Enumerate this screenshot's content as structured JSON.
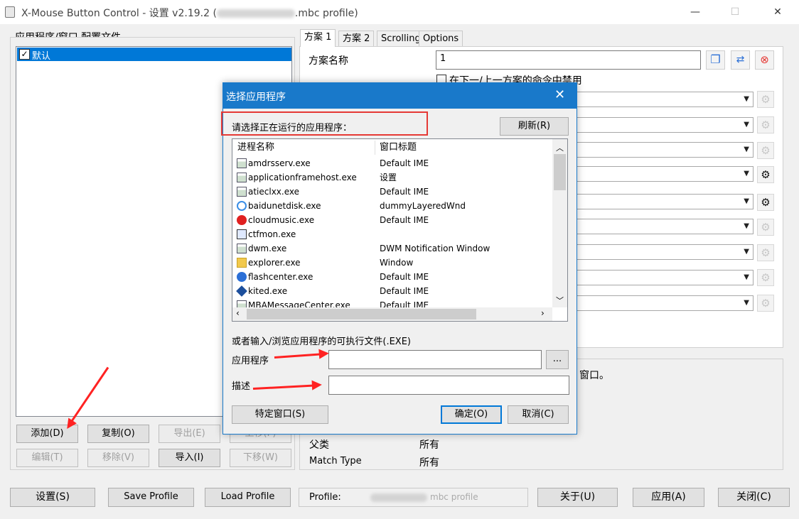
{
  "window": {
    "title_prefix": "X-Mouse Button Control - 设置 v2.19.2 (",
    "title_suffix": ".mbc profile)",
    "minimize": "—",
    "maximize": "☐",
    "close": "✕"
  },
  "left_panel": {
    "group_label": "应用程序/窗口 配置文件",
    "items": [
      {
        "label": "默认",
        "checked": true
      }
    ],
    "buttons": {
      "add": "添加(D)",
      "copy": "复制(O)",
      "export": "导出(E)",
      "move_up": "上移(P)",
      "edit": "编辑(T)",
      "remove": "移除(V)",
      "import": "导入(I)",
      "move_down": "下移(W)"
    }
  },
  "tabs": [
    "方案 1",
    "方案 2",
    "Scrolling",
    "Options"
  ],
  "scheme": {
    "name_label": "方案名称",
    "name_value": "1",
    "disable_label": "在下一/上一方案的命令中禁用"
  },
  "info": {
    "right_text": "窗口。",
    "parent_label": "父类",
    "parent_value": "所有",
    "match_label": "Match Type",
    "match_value": "所有"
  },
  "dialog": {
    "title": "选择应用程序",
    "prompt": "请选择正在运行的应用程序：",
    "refresh": "刷新(R)",
    "col_process": "进程名称",
    "col_window": "窗口标题",
    "processes": [
      {
        "name": "amdrsserv.exe",
        "title": "Default IME",
        "icon": "window-icon"
      },
      {
        "name": "applicationframehost.exe",
        "title": "设置",
        "icon": "window-icon"
      },
      {
        "name": "atieclxx.exe",
        "title": "Default IME",
        "icon": "window-icon"
      },
      {
        "name": "baidunetdisk.exe",
        "title": "dummyLayeredWnd",
        "icon": "cloud-icon"
      },
      {
        "name": "cloudmusic.exe",
        "title": "Default IME",
        "icon": "music-icon"
      },
      {
        "name": "ctfmon.exe",
        "title": "",
        "icon": "pen-icon"
      },
      {
        "name": "dwm.exe",
        "title": "DWM Notification Window",
        "icon": "window-icon"
      },
      {
        "name": "explorer.exe",
        "title": "Window",
        "icon": "folder-icon"
      },
      {
        "name": "flashcenter.exe",
        "title": "Default IME",
        "icon": "flash-icon"
      },
      {
        "name": "kited.exe",
        "title": "Default IME",
        "icon": "kite-icon"
      },
      {
        "name": "MBAMessageCenter.exe",
        "title": "Default IME",
        "icon": "window-icon"
      }
    ],
    "browse_label": "或者输入/浏览应用程序的可执行文件(.EXE)",
    "app_label": "应用程序",
    "app_value": "",
    "browse_button": "...",
    "desc_label": "描述",
    "desc_value": "",
    "specific_window": "特定窗口(S)",
    "ok": "确定(O)",
    "cancel": "取消(C)"
  },
  "bottom": {
    "settings": "设置(S)",
    "save_profile": "Save Profile",
    "load_profile": "Load Profile",
    "profile_label": "Profile:",
    "profile_value_suffix": "mbc profile",
    "about": "关于(U)",
    "apply": "应用(A)",
    "close": "关闭(C)"
  },
  "colors": {
    "accent": "#1979ca",
    "selection": "#0078d7",
    "highlight_red": "#e53935"
  }
}
